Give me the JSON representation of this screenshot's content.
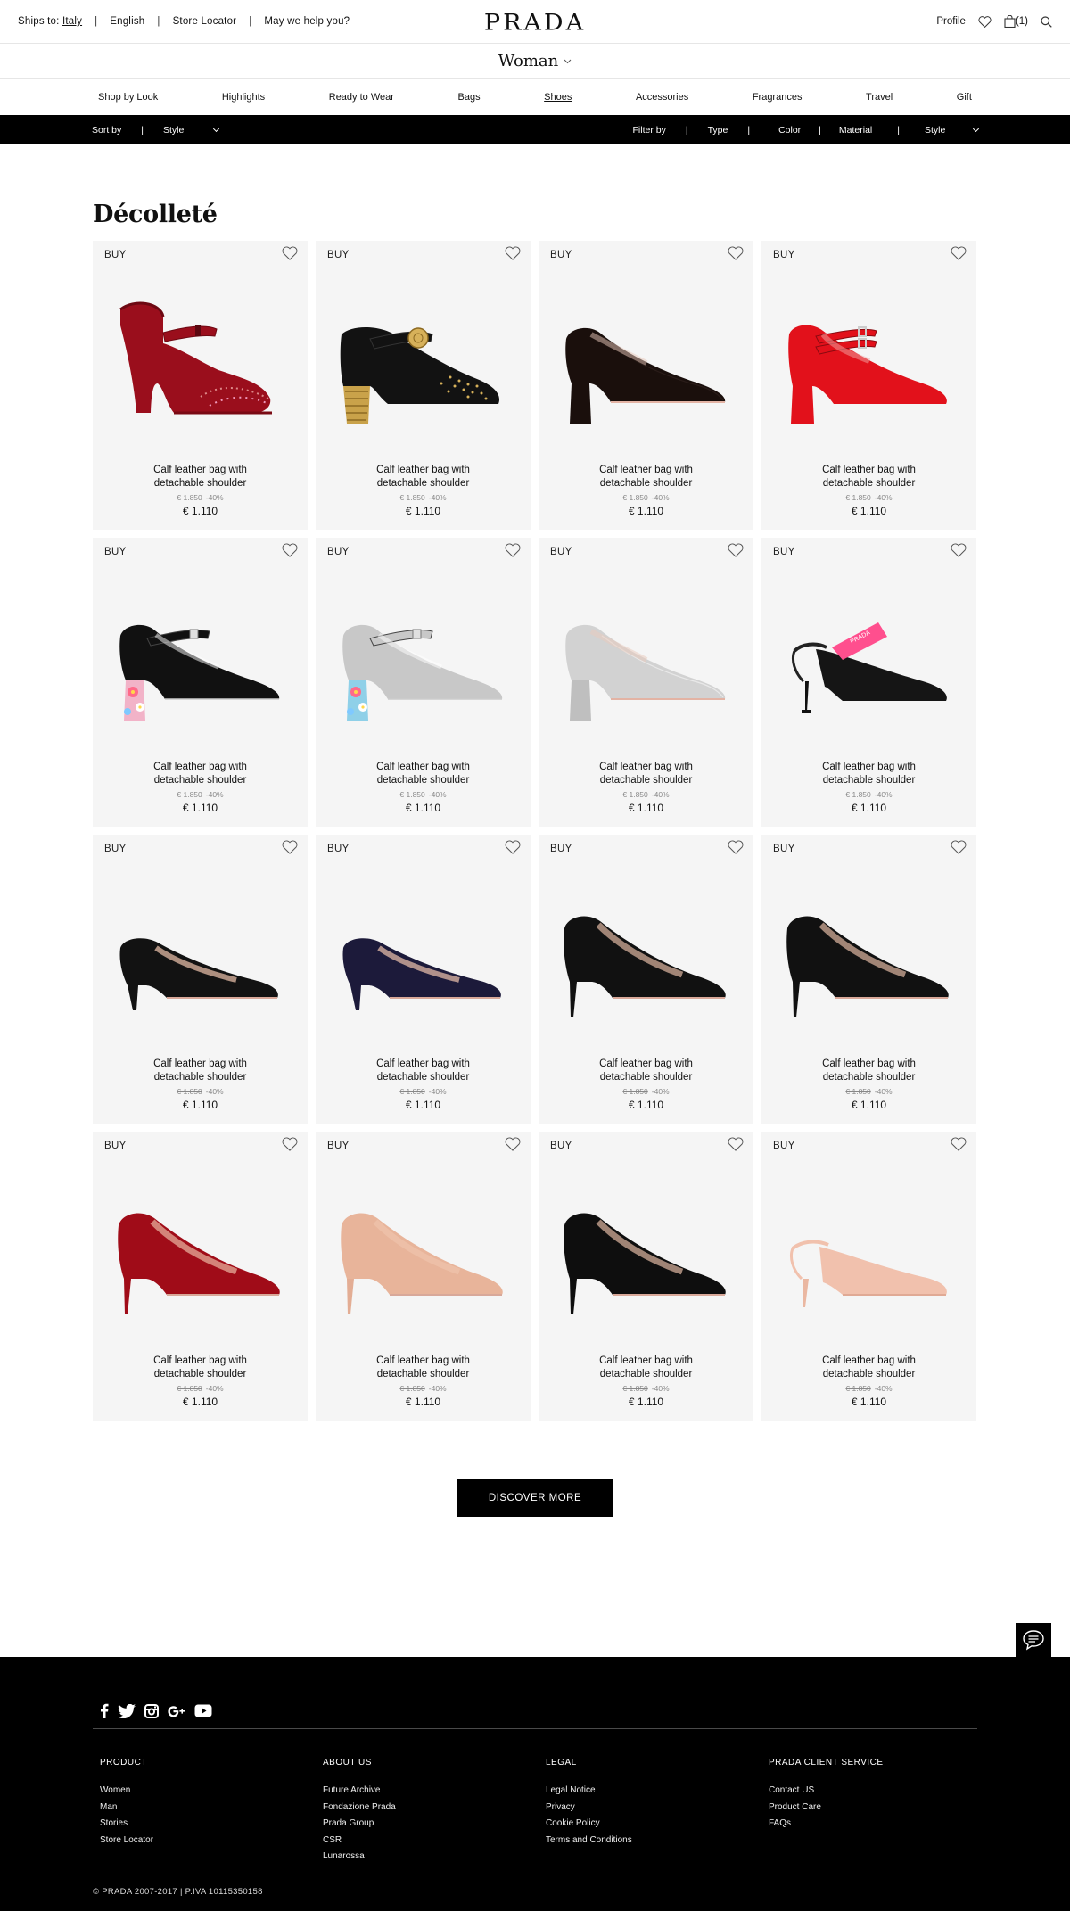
{
  "topbar": {
    "ships_to_label": "Ships to:",
    "ships_to_country": "Italy",
    "language": "English",
    "store_locator": "Store Locator",
    "help": "May we help you?",
    "logo": "PRADA",
    "profile": "Profile",
    "cart_count": "(1)"
  },
  "category": {
    "label": "Woman"
  },
  "nav": {
    "items": [
      "Shop by Look",
      "Highlights",
      "Ready to Wear",
      "Bags",
      "Shoes",
      "Accessories",
      "Fragrances",
      "Travel",
      "Gift"
    ],
    "active": "Shoes"
  },
  "filterbar": {
    "sort_by": "Sort by",
    "sort_style": "Style",
    "filter_by": "Filter by",
    "type": "Type",
    "color": "Color",
    "material": "Material",
    "style": "Style"
  },
  "section_title": "Décolleté",
  "products": [
    {
      "buy": "BUY",
      "name": "Calf leather bag with detachable shoulder",
      "old_price": "€ 1.850",
      "discount": "-40%",
      "price": "€ 1.110",
      "shoe_style": "studded-platform-velvet",
      "primary_color": "#9a0e1c",
      "heel_color": "#a3101e"
    },
    {
      "buy": "BUY",
      "name": "Calf leather bag with detachable shoulder",
      "old_price": "€ 1.850",
      "discount": "-40%",
      "price": "€ 1.110",
      "shoe_style": "maryjane-gold-heel",
      "primary_color": "#121212",
      "heel_color": "#c9a24a"
    },
    {
      "buy": "BUY",
      "name": "Calf leather bag with detachable shoulder",
      "old_price": "€ 1.850",
      "discount": "-40%",
      "price": "€ 1.110",
      "shoe_style": "block-pump",
      "primary_color": "#1a0f0c",
      "heel_color": "#1a0f0c"
    },
    {
      "buy": "BUY",
      "name": "Calf leather bag with detachable shoulder",
      "old_price": "€ 1.850",
      "discount": "-40%",
      "price": "€ 1.110",
      "shoe_style": "double-strap",
      "primary_color": "#e2111b",
      "heel_color": "#e2111b"
    },
    {
      "buy": "BUY",
      "name": "Calf leather bag with detachable shoulder",
      "old_price": "€ 1.850",
      "discount": "-40%",
      "price": "€ 1.110",
      "shoe_style": "maryjane-flower-heel",
      "primary_color": "#111111",
      "heel_color": "#f2b3c8"
    },
    {
      "buy": "BUY",
      "name": "Calf leather bag with detachable shoulder",
      "old_price": "€ 1.850",
      "discount": "-40%",
      "price": "€ 1.110",
      "shoe_style": "maryjane-flower-heel",
      "primary_color": "#c8c8c8",
      "heel_color": "#8fd0e8"
    },
    {
      "buy": "BUY",
      "name": "Calf leather bag with detachable shoulder",
      "old_price": "€ 1.850",
      "discount": "-40%",
      "price": "€ 1.110",
      "shoe_style": "block-pump",
      "primary_color": "#d2d2d2",
      "heel_color": "#bfbfbf"
    },
    {
      "buy": "BUY",
      "name": "Calf leather bag with detachable shoulder",
      "old_price": "€ 1.850",
      "discount": "-40%",
      "price": "€ 1.110",
      "shoe_style": "slingback-kitten",
      "primary_color": "#151515",
      "heel_color": "#ff4f8e"
    },
    {
      "buy": "BUY",
      "name": "Calf leather bag with detachable shoulder",
      "old_price": "€ 1.850",
      "discount": "-40%",
      "price": "€ 1.110",
      "shoe_style": "kitten-pump",
      "primary_color": "#121212",
      "heel_color": "#121212"
    },
    {
      "buy": "BUY",
      "name": "Calf leather bag with detachable shoulder",
      "old_price": "€ 1.850",
      "discount": "-40%",
      "price": "€ 1.110",
      "shoe_style": "kitten-pump",
      "primary_color": "#1c1a3a",
      "heel_color": "#1c1a3a"
    },
    {
      "buy": "BUY",
      "name": "Calf leather bag with detachable shoulder",
      "old_price": "€ 1.850",
      "discount": "-40%",
      "price": "€ 1.110",
      "shoe_style": "stiletto-pump",
      "primary_color": "#111111",
      "heel_color": "#111111"
    },
    {
      "buy": "BUY",
      "name": "Calf leather bag with detachable shoulder",
      "old_price": "€ 1.850",
      "discount": "-40%",
      "price": "€ 1.110",
      "shoe_style": "stiletto-pump",
      "primary_color": "#111111",
      "heel_color": "#111111"
    },
    {
      "buy": "BUY",
      "name": "Calf leather bag with detachable shoulder",
      "old_price": "€ 1.850",
      "discount": "-40%",
      "price": "€ 1.110",
      "shoe_style": "stiletto-pump",
      "primary_color": "#a00c18",
      "heel_color": "#a00c18"
    },
    {
      "buy": "BUY",
      "name": "Calf leather bag with detachable shoulder",
      "old_price": "€ 1.850",
      "discount": "-40%",
      "price": "€ 1.110",
      "shoe_style": "stiletto-pump",
      "primary_color": "#e8b49a",
      "heel_color": "#e3ad94"
    },
    {
      "buy": "BUY",
      "name": "Calf leather bag with detachable shoulder",
      "old_price": "€ 1.850",
      "discount": "-40%",
      "price": "€ 1.110",
      "shoe_style": "stiletto-pump",
      "primary_color": "#0e0e0e",
      "heel_color": "#0e0e0e"
    },
    {
      "buy": "BUY",
      "name": "Calf leather bag with detachable shoulder",
      "old_price": "€ 1.850",
      "discount": "-40%",
      "price": "€ 1.110",
      "shoe_style": "slingback-pump",
      "primary_color": "#f1c1ad",
      "heel_color": "#eab7a1"
    }
  ],
  "discover_more": "DISCOVER MORE",
  "footer": {
    "social_icons": [
      "facebook-icon",
      "twitter-icon",
      "instagram-icon",
      "google-plus-icon",
      "youtube-icon"
    ],
    "columns": [
      {
        "heading": "PRODUCT",
        "links": [
          "Women",
          "Man",
          "Stories",
          "Store Locator"
        ]
      },
      {
        "heading": "ABOUT US",
        "links": [
          "Future Archive",
          "Fondazione Prada",
          "Prada Group",
          "CSR",
          "Lunarossa"
        ]
      },
      {
        "heading": "LEGAL",
        "links": [
          "Legal Notice",
          "Privacy",
          "Cookie Policy",
          "Terms and Conditions"
        ]
      },
      {
        "heading": "PRADA CLIENT SERVICE",
        "links": [
          "Contact US",
          "Product Care",
          "FAQs"
        ]
      }
    ],
    "copyright": "© PRADA 2007-2017 | P.IVA 10115350158"
  },
  "colors": {
    "accent": "#000000",
    "card_bg": "#f5f5f5"
  }
}
